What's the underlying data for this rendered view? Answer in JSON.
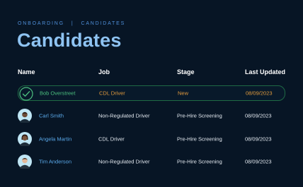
{
  "breadcrumb": {
    "root": "ONBOARDING",
    "separator": "|",
    "current": "CANDIDATES"
  },
  "page": {
    "title": "Candidates"
  },
  "table": {
    "columns": [
      "Name",
      "Job",
      "Stage",
      "Last Updated"
    ],
    "rows": [
      {
        "name": "Bob Overstreet",
        "job": "CDL Driver",
        "stage": "New",
        "updated": "08/09/2023",
        "selected": true,
        "icon": "check-circle-icon"
      },
      {
        "name": "Carl Smith",
        "job": "Non-Regulated Driver",
        "stage": "Pre-Hire Screening",
        "updated": "08/09/2023",
        "icon": "avatar"
      },
      {
        "name": "Angela Martin",
        "job": "CDL Driver",
        "stage": "Pre-Hire Screening",
        "updated": "08/09/2023",
        "icon": "avatar"
      },
      {
        "name": "Tim Anderson",
        "job": "Non-Regulated Driver",
        "stage": "Pre-Hire Screening",
        "updated": "08/09/2023",
        "icon": "avatar"
      }
    ]
  },
  "colors": {
    "background": "#071525",
    "title": "#8ec3f2",
    "link": "#5aa9ea",
    "selected_name": "#4cc07f",
    "selected_accent": "#e39b3d",
    "selected_border": "#1f6b45"
  }
}
